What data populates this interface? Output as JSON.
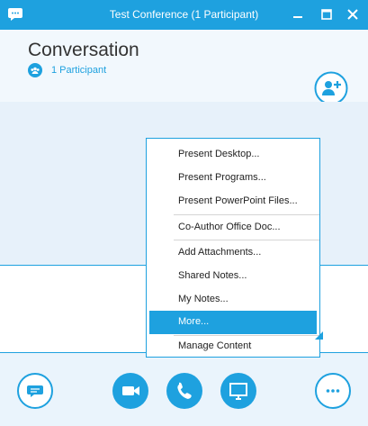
{
  "window": {
    "title": "Test Conference (1 Participant)"
  },
  "header": {
    "title": "Conversation",
    "participants_label": "1 Participant"
  },
  "menu": {
    "items": [
      {
        "label": "Present Desktop..."
      },
      {
        "label": "Present Programs..."
      },
      {
        "label": "Present PowerPoint Files..."
      },
      {
        "label": "Co-Author Office Doc..."
      },
      {
        "label": "Add Attachments..."
      },
      {
        "label": "Shared Notes..."
      },
      {
        "label": "My Notes..."
      },
      {
        "label": "More..."
      },
      {
        "label": "Manage Content"
      }
    ],
    "highlighted": "More..."
  },
  "toolbar": {
    "buttons": [
      "chat-icon",
      "video-icon",
      "phone-icon",
      "present-screen-icon",
      "more-options-icon"
    ]
  },
  "colors": {
    "accent": "#1ea1df",
    "panel": "#e7f1fa",
    "header_bg": "#f2f8fd"
  }
}
